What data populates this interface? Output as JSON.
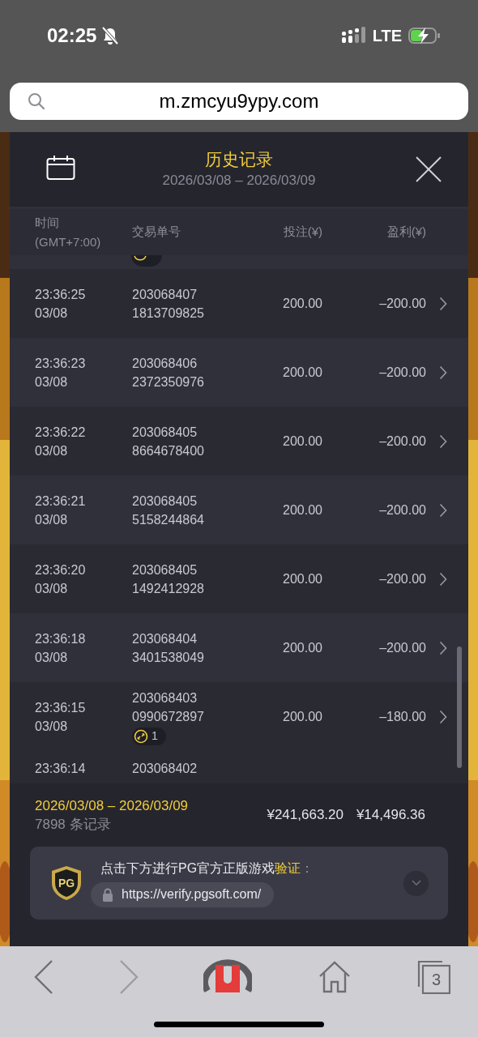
{
  "status_bar": {
    "time": "02:25",
    "network": "LTE"
  },
  "address_bar": {
    "url": "m.zmcyu9ypy.com"
  },
  "dialog": {
    "title": "历史记录",
    "date_range": "2026/03/08 – 2026/03/09"
  },
  "table": {
    "columns": [
      {
        "label": "时间",
        "sublabel": "(GMT+7:00)"
      },
      {
        "label": "交易单号"
      },
      {
        "label": "投注(¥)"
      },
      {
        "label": "盈利(¥)"
      }
    ],
    "rows": [
      {
        "time": "23:36:25",
        "date": "03/08",
        "order_1": "203068407",
        "order_2": "1813709825",
        "bet": "200.00",
        "profit": "–200.00"
      },
      {
        "time": "23:36:23",
        "date": "03/08",
        "order_1": "203068406",
        "order_2": "2372350976",
        "bet": "200.00",
        "profit": "–200.00"
      },
      {
        "time": "23:36:22",
        "date": "03/08",
        "order_1": "203068405",
        "order_2": "8664678400",
        "bet": "200.00",
        "profit": "–200.00"
      },
      {
        "time": "23:36:21",
        "date": "03/08",
        "order_1": "203068405",
        "order_2": "5158244864",
        "bet": "200.00",
        "profit": "–200.00"
      },
      {
        "time": "23:36:20",
        "date": "03/08",
        "order_1": "203068405",
        "order_2": "1492412928",
        "bet": "200.00",
        "profit": "–200.00"
      },
      {
        "time": "23:36:18",
        "date": "03/08",
        "order_1": "203068404",
        "order_2": "3401538049",
        "bet": "200.00",
        "profit": "–200.00"
      },
      {
        "time": "23:36:15",
        "date": "03/08",
        "order_1": "203068403",
        "order_2": "0990672897",
        "bet": "200.00",
        "profit": "–180.00",
        "badge": "1"
      }
    ],
    "partial_bottom_row": {
      "time": "23:36:14",
      "order_1": "203068402"
    }
  },
  "summary": {
    "date_range": "2026/03/08 – 2026/03/09",
    "count": "7898 条记录",
    "total_bet": "¥241,663.20",
    "total_profit": "¥14,496.36"
  },
  "verify": {
    "logo": "PG",
    "prompt": "点击下方进行PG官方正版游戏",
    "highlight": "验证",
    "suffix": "：",
    "url": "https://verify.pgsoft.com/"
  },
  "browser_toolbar": {
    "forward_disabled": true,
    "tab_count": "3"
  }
}
